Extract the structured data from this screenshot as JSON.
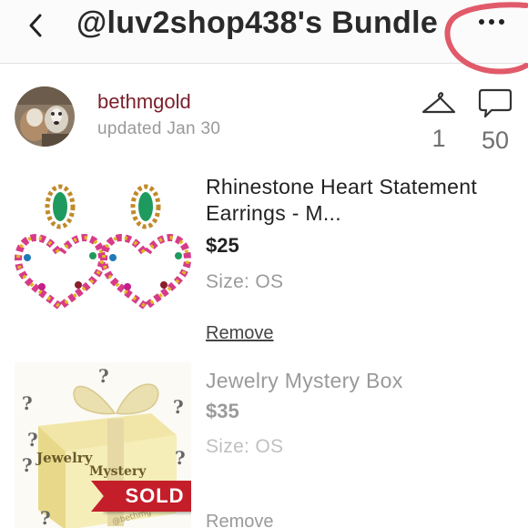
{
  "header": {
    "title": "@luv2shop438's Bundle",
    "back_icon": "chevron-left-icon",
    "more_icon": "more-horizontal-icon"
  },
  "seller": {
    "username": "bethmgold",
    "updated": "updated Jan 30",
    "likes_count": "1",
    "comments_count": "50"
  },
  "items": [
    {
      "title": "Rhinestone Heart Statement Earrings - M...",
      "price": "$25",
      "size": "Size: OS",
      "remove_label": "Remove"
    },
    {
      "title": "Jewelry Mystery Box",
      "price": "$35",
      "size": "Size: OS",
      "remove_label": "Remove",
      "badge": "SOLD",
      "image_text_1": "Jewelry",
      "image_text_2": "Mystery",
      "watermark": "@bethmg"
    }
  ],
  "colors": {
    "seller_name": "#7a1f2b",
    "sold_badge": "#c41e2a",
    "scribble": "#e05a6a"
  }
}
